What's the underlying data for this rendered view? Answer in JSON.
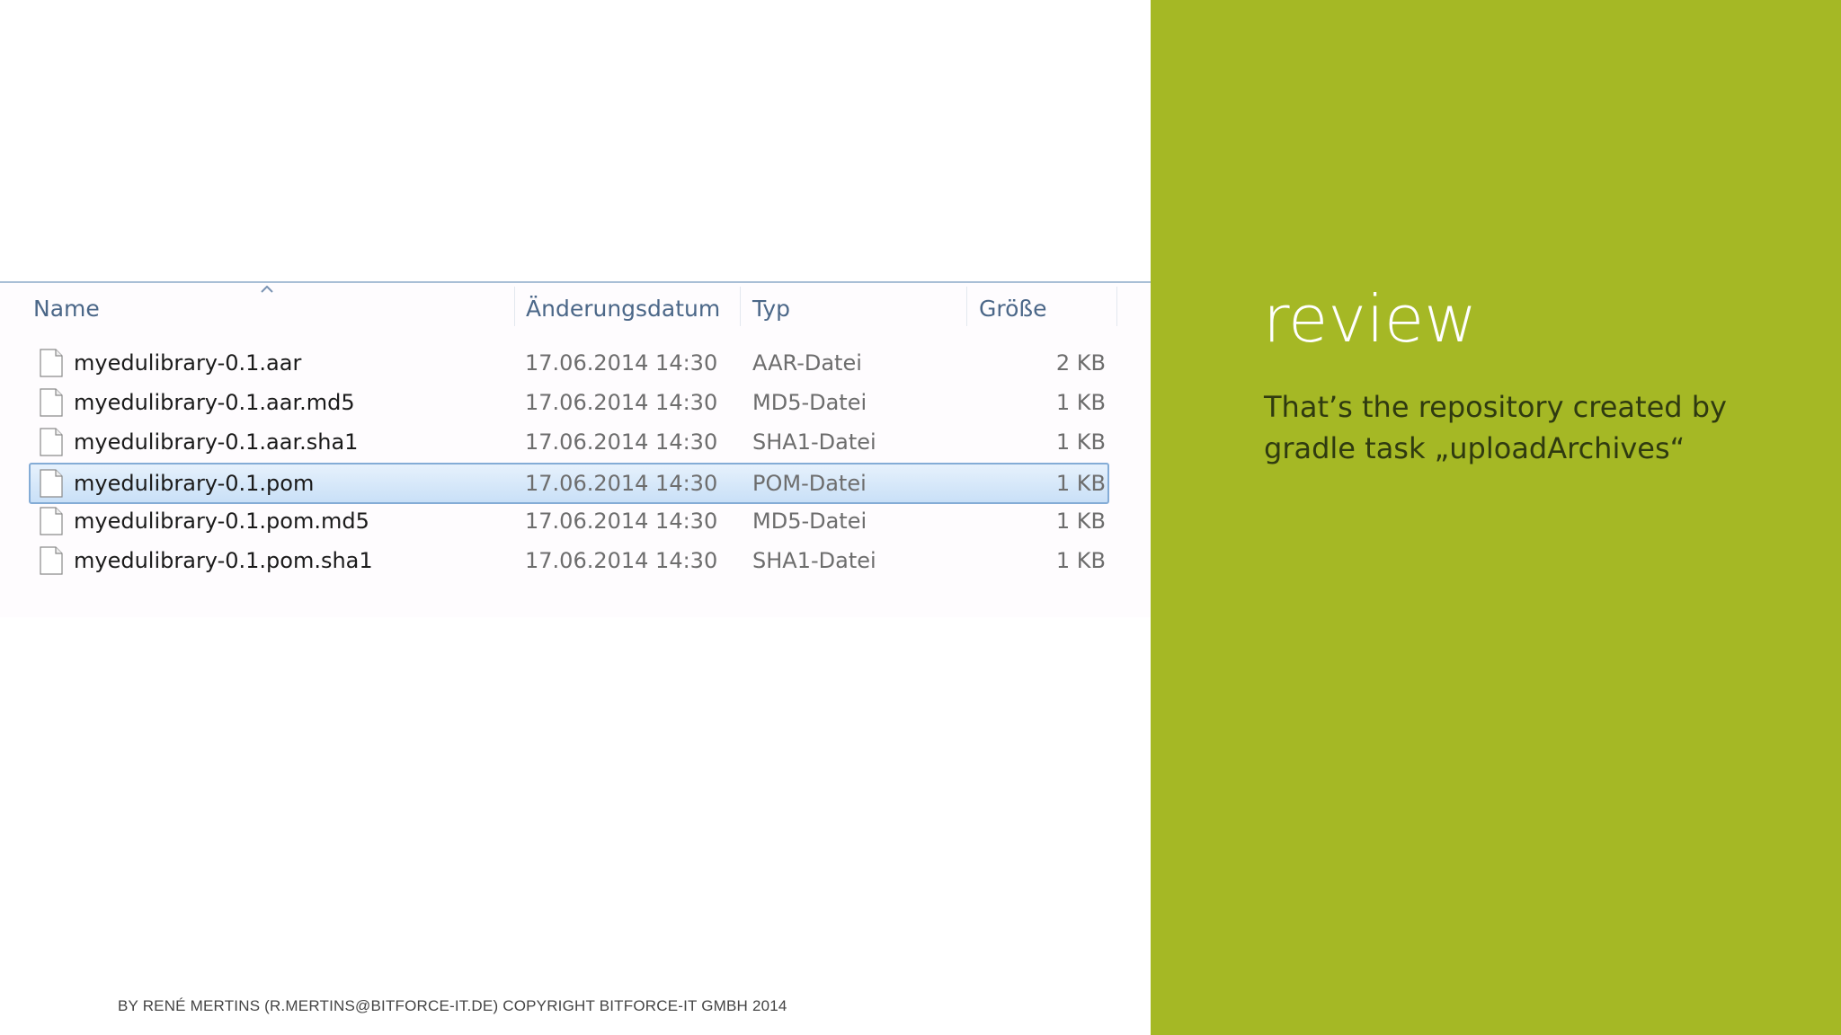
{
  "explorer": {
    "columns": {
      "name": "Name",
      "date": "Änderungsdatum",
      "type": "Typ",
      "size": "Größe"
    },
    "sort_icon": "sort-ascending-icon",
    "files": [
      {
        "name": "myedulibrary-0.1.aar",
        "date": "17.06.2014 14:30",
        "type": "AAR-Datei",
        "size": "2 KB",
        "selected": false
      },
      {
        "name": "myedulibrary-0.1.aar.md5",
        "date": "17.06.2014 14:30",
        "type": "MD5-Datei",
        "size": "1 KB",
        "selected": false
      },
      {
        "name": "myedulibrary-0.1.aar.sha1",
        "date": "17.06.2014 14:30",
        "type": "SHA1-Datei",
        "size": "1 KB",
        "selected": false
      },
      {
        "name": "myedulibrary-0.1.pom",
        "date": "17.06.2014 14:30",
        "type": "POM-Datei",
        "size": "1 KB",
        "selected": true
      },
      {
        "name": "myedulibrary-0.1.pom.md5",
        "date": "17.06.2014 14:30",
        "type": "MD5-Datei",
        "size": "1 KB",
        "selected": false
      },
      {
        "name": "myedulibrary-0.1.pom.sha1",
        "date": "17.06.2014 14:30",
        "type": "SHA1-Datei",
        "size": "1 KB",
        "selected": false
      }
    ],
    "file_icon": "document-icon"
  },
  "slide": {
    "title": "review",
    "description": "That’s the repository created by gradle task „uploadArchives“",
    "footer": "BY RENÉ MERTINS (R.MERTINS@BITFORCE-IT.DE) COPYRIGHT BITFORCE-IT GMBH 2014"
  },
  "colors": {
    "accent_green": "#a5b825",
    "header_text": "#4b6788",
    "selection_border": "#84acd6"
  }
}
